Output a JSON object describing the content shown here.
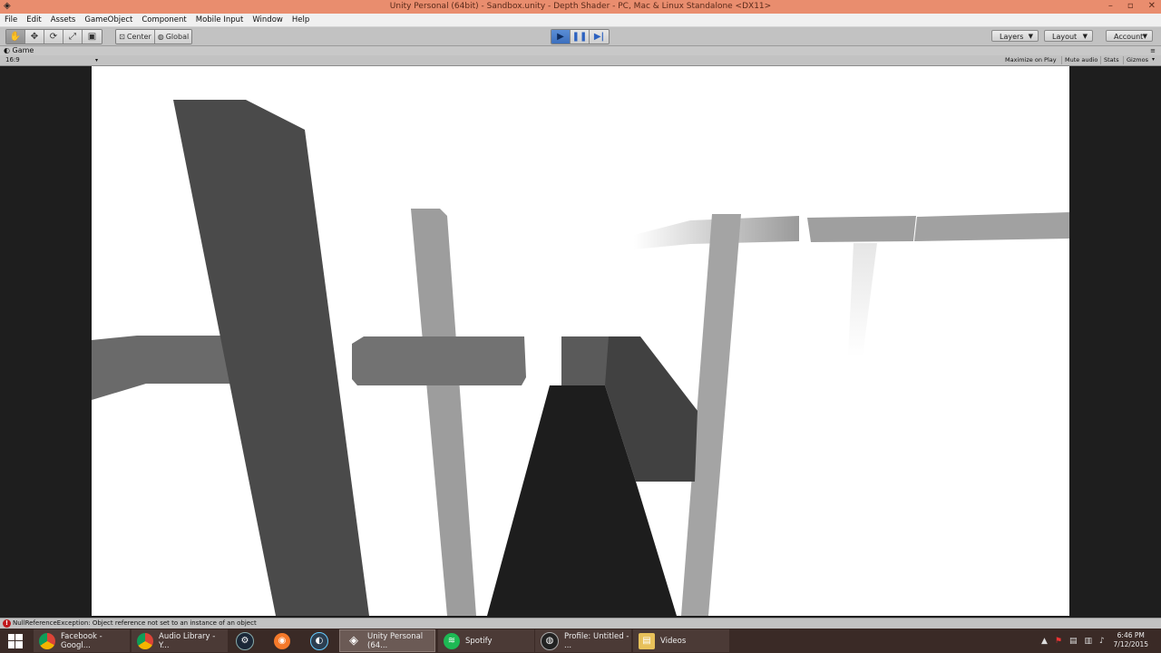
{
  "window": {
    "title": "Unity Personal (64bit) - Sandbox.unity - Depth Shader - PC, Mac & Linux Standalone <DX11>",
    "buttons": [
      "–",
      "▫",
      "✕"
    ]
  },
  "menu": [
    "File",
    "Edit",
    "Assets",
    "GameObject",
    "Component",
    "Mobile Input",
    "Window",
    "Help"
  ],
  "toolbar": {
    "tools": [
      "hand-tool",
      "move-tool",
      "rotate-tool",
      "scale-tool",
      "rect-tool"
    ],
    "pivot_label": "Center",
    "space_label": "Global",
    "play_controls": [
      "play",
      "pause",
      "step"
    ],
    "layers_label": "Layers",
    "layout_label": "Layout",
    "account_label": "Account"
  },
  "game_tab": {
    "label": "Game",
    "aspect": "16:9",
    "buttons": [
      "Maximize on Play",
      "Mute audio",
      "Stats",
      "Gizmos"
    ]
  },
  "status": {
    "message": "NullReferenceException: Object reference not set to an instance of an object"
  },
  "taskbar": {
    "items": [
      {
        "label": "Facebook - Googl...",
        "icon": "chrome-icon"
      },
      {
        "label": "Audio Library - Y...",
        "icon": "chrome-icon"
      },
      {
        "label": "",
        "icon": "steam-icon"
      },
      {
        "label": "",
        "icon": "blender-icon"
      },
      {
        "label": "",
        "icon": "app-icon"
      },
      {
        "label": "Unity Personal (64...",
        "icon": "unity-icon"
      },
      {
        "label": "Spotify",
        "icon": "spotify-icon"
      },
      {
        "label": "Profile: Untitled - ...",
        "icon": "obs-icon"
      },
      {
        "label": "Videos",
        "icon": "folder-icon"
      }
    ],
    "time": "6:46 PM",
    "date": "7/12/2015"
  },
  "colors": {
    "title_bar": "#e98d6e",
    "toolbar": "#c2c2c2",
    "play_active": "#3c6fbd",
    "game_background": "#ffffff",
    "side_background": "#1e1e1e",
    "taskbar": "#3a2a26",
    "error": "#c0171b"
  }
}
